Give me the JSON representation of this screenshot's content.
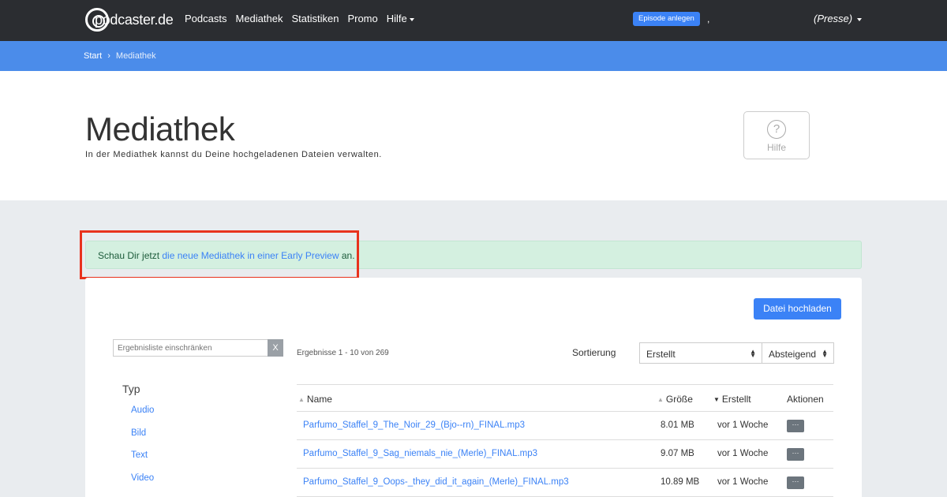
{
  "navbar": {
    "logo_text": "podcaster.de",
    "links": [
      {
        "label": "Podcasts"
      },
      {
        "label": "Mediathek"
      },
      {
        "label": "Statistiken"
      },
      {
        "label": "Promo"
      },
      {
        "label": "Hilfe"
      }
    ],
    "episode_button": "Episode anlegen",
    "separator": ",",
    "user_menu": "(Presse)"
  },
  "breadcrumb": {
    "start": "Start",
    "separator": "›",
    "current": "Mediathek"
  },
  "header": {
    "title": "Mediathek",
    "subtitle": "In der Mediathek kannst du Deine hochgeladenen Dateien verwalten.",
    "help_label": "Hilfe",
    "help_icon": "question-circle-icon"
  },
  "alert": {
    "prefix": "Schau Dir jetzt",
    "link": "die neue Mediathek in einer Early Preview",
    "suffix": "an."
  },
  "toolbar": {
    "upload_label": "Datei hochladen",
    "filter_placeholder": "Ergebnisliste einschränken",
    "filter_clear": "X"
  },
  "sidebar": {
    "title": "Typ",
    "items": [
      "Audio",
      "Bild",
      "Text",
      "Video"
    ]
  },
  "results": {
    "count_text": "Ergebnisse 1 - 10 von 269",
    "sort_label": "Sortierung",
    "sort_field": "Erstellt",
    "sort_order": "Absteigend"
  },
  "table": {
    "columns": {
      "name": "Name",
      "size": "Größe",
      "created": "Erstellt",
      "actions": "Aktionen"
    },
    "rows": [
      {
        "name": "Parfumo_Staffel_9_The_Noir_29_(Bjo--rn)_FINAL.mp3",
        "size": "8.01 MB",
        "created": "vor 1 Woche",
        "action": "···"
      },
      {
        "name": "Parfumo_Staffel_9_Sag_niemals_nie_(Merle)_FINAL.mp3",
        "size": "9.07 MB",
        "created": "vor 1 Woche",
        "action": "···"
      },
      {
        "name": "Parfumo_Staffel_9_Oops-_they_did_it_again_(Merle)_FINAL.mp3",
        "size": "10.89 MB",
        "created": "vor 1 Woche",
        "action": "···"
      }
    ]
  },
  "colors": {
    "navbar_bg": "#2b2d31",
    "breadcrumb_bg": "#4b8cea",
    "accent": "#3b82f6",
    "alert_bg": "#d4f0e0",
    "highlight_border": "#e8321d"
  }
}
